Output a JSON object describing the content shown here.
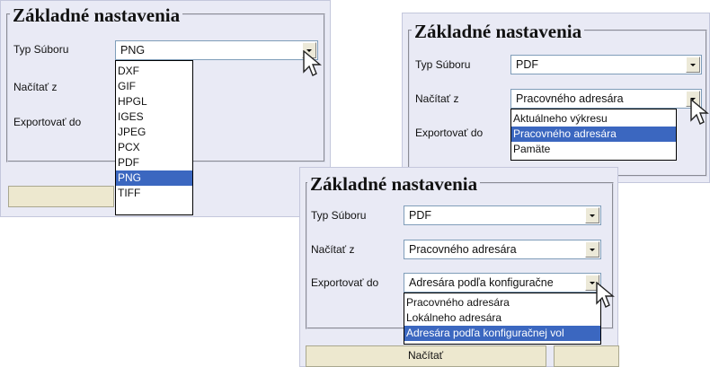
{
  "legend_title": "Základné nastavenia",
  "labels": {
    "file_type": "Typ Súboru",
    "load_from": "Načítať z",
    "export_to": "Exportovať do"
  },
  "panel1": {
    "file_type_value": "PNG",
    "file_type_options": [
      "DXF",
      "GIF",
      "HPGL",
      "IGES",
      "JPEG",
      "PCX",
      "PDF",
      "PNG",
      "TIFF"
    ],
    "file_type_selected": "PNG"
  },
  "panel2": {
    "file_type_value": "PDF",
    "load_from_value": "Pracovného adresára",
    "load_from_options": [
      "Aktuálneho výkresu",
      "Pracovného adresára",
      "Pamäte"
    ],
    "load_from_selected": "Pracovného adresára"
  },
  "panel3": {
    "file_type_value": "PDF",
    "load_from_value": "Pracovného adresára",
    "export_to_value": "Adresára podľa konfiguračne",
    "export_to_options": [
      "Pracovného adresára",
      "Lokálneho adresára",
      "Adresára podľa konfiguračnej vol"
    ],
    "export_to_selected": "Adresára podľa konfiguračnej vol",
    "load_button": "Načítať"
  },
  "colors": {
    "panel_bg": "#e9eaf5",
    "selection": "#3b67c0",
    "button_bg": "#ede8cf"
  }
}
